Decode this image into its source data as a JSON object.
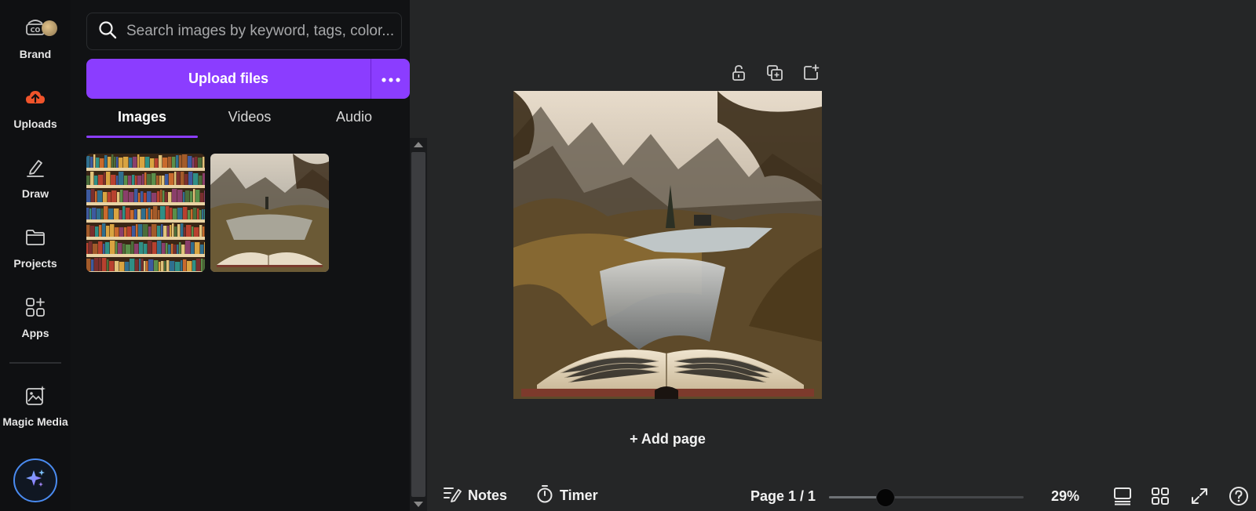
{
  "rail": {
    "items": [
      {
        "label": "Brand",
        "icon": "brand-icon"
      },
      {
        "label": "Uploads",
        "icon": "upload-cloud-icon"
      },
      {
        "label": "Draw",
        "icon": "draw-pen-icon"
      },
      {
        "label": "Projects",
        "icon": "folder-icon"
      },
      {
        "label": "Apps",
        "icon": "apps-grid-icon"
      },
      {
        "label": "Magic Media",
        "icon": "magic-media-icon"
      }
    ],
    "assistant_icon": "sparkle-icon",
    "accent_color": "#8b3dff",
    "uploads_color": "#f0542b"
  },
  "panel": {
    "search_placeholder": "Search images by keyword, tags, color...",
    "upload_label": "Upload files",
    "tabs": [
      {
        "label": "Images",
        "active": true
      },
      {
        "label": "Videos",
        "active": false
      },
      {
        "label": "Audio",
        "active": false
      }
    ],
    "thumbnails": [
      {
        "icon": "bookshelf-image-icon"
      },
      {
        "icon": "open-book-landscape-image-icon"
      }
    ]
  },
  "canvas": {
    "tools": [
      "lock-icon",
      "duplicate-icon",
      "add-page-icon"
    ],
    "add_page_label": "+ Add page"
  },
  "bottom": {
    "notes_label": "Notes",
    "timer_label": "Timer",
    "page_indicator": "Page 1 / 1",
    "zoom_fraction": 0.29,
    "zoom_label": "29%"
  }
}
